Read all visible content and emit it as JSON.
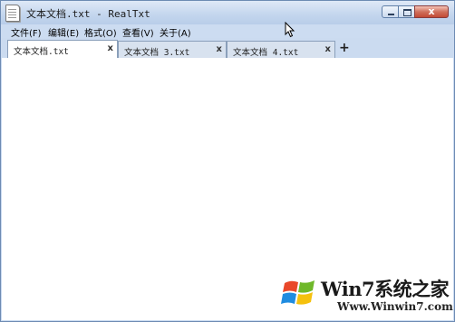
{
  "window": {
    "title": "文本文档.txt - RealTxt",
    "icons": {
      "app": "notepad-icon",
      "minimize": "minimize-icon",
      "maximize": "maximize-icon",
      "close": "close-icon"
    },
    "close_glyph": "x"
  },
  "menu": {
    "items": [
      {
        "label": "文件(F)"
      },
      {
        "label": "编辑(E)"
      },
      {
        "label": "格式(O)"
      },
      {
        "label": "查看(V)"
      },
      {
        "label": "关于(A)"
      }
    ]
  },
  "tabs": [
    {
      "label": "文本文档.txt",
      "active": true,
      "close": "x"
    },
    {
      "label": "文本文档 3.txt",
      "active": false,
      "close": "x"
    },
    {
      "label": "文本文档 4.txt",
      "active": false,
      "close": "x"
    }
  ],
  "new_tab_label": "+",
  "editor": {
    "content": ""
  },
  "watermark": {
    "brand": "Win7系统之家",
    "url": "Www.Winwin7.com",
    "icon": "windows-flag-logo"
  },
  "colors": {
    "titlebar": "#c5d7ee",
    "menubar": "#ccdcf1",
    "tab_active": "#ffffff",
    "tab_inactive": "#d8e2ef",
    "close_button": "#c24a35"
  }
}
